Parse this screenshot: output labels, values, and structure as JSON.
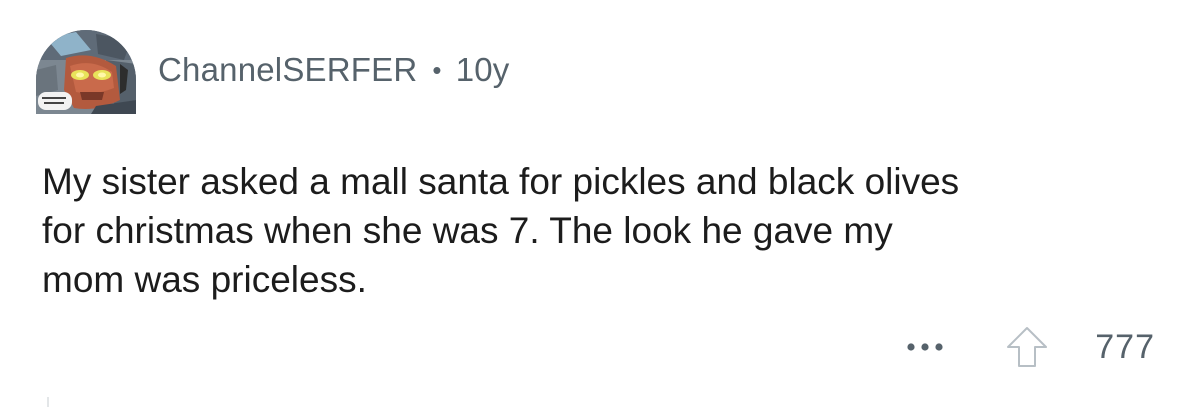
{
  "comment": {
    "author": "ChannelSERFER",
    "separator": "•",
    "age": "10y",
    "avatar_icon": "robot-comic-avatar-icon",
    "body_lines": [
      "My sister asked a mall santa for pickles and black olives",
      "for christmas when she was 7. The look he gave my",
      "mom was priceless."
    ],
    "actions": {
      "more_icon": "more-options-icon",
      "upvote_icon": "upvote-arrow-icon",
      "score": "777"
    }
  },
  "colors": {
    "text_primary": "#1c1c1c",
    "text_meta": "#56626b",
    "icon_outline": "#b7bfc5",
    "background": "#ffffff"
  }
}
